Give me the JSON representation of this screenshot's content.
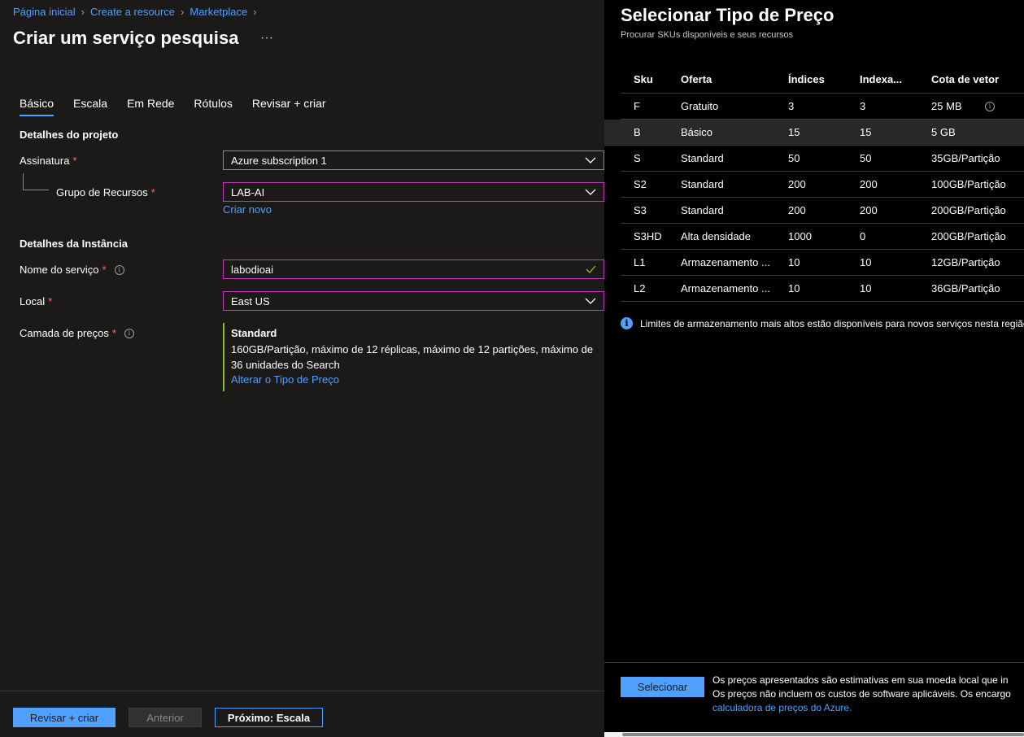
{
  "breadcrumb": [
    "Página inicial",
    "Create a resource",
    "Marketplace"
  ],
  "page_title": "Criar um serviço pesquisa",
  "more_label": "···",
  "tabs": [
    "Básico",
    "Escala",
    "Em Rede",
    "Rótulos",
    "Revisar + criar"
  ],
  "project": {
    "heading": "Detalhes do projeto",
    "subscription_label": "Assinatura",
    "subscription_value": "Azure subscription 1",
    "resource_group_label": "Grupo de Recursos",
    "resource_group_value": "LAB-AI",
    "create_new": "Criar novo",
    "required_mark": "*"
  },
  "instance": {
    "heading": "Detalhes da Instância",
    "service_name_label": "Nome do serviço",
    "service_name_value": "labodioai",
    "location_label": "Local",
    "location_value": "East US",
    "tier_label": "Camada de preços",
    "tier_name": "Standard",
    "tier_desc": "160GB/Partição, máximo de 12 réplicas, máximo de 12 partições, máximo de 36 unidades do Search",
    "tier_change": "Alterar o Tipo de Preço"
  },
  "footer": {
    "review_create": "Revisar + criar",
    "previous": "Anterior",
    "next": "Próximo: Escala"
  },
  "panel": {
    "title": "Selecionar Tipo de Preço",
    "subtitle": "Procurar SKUs disponíveis e seus recursos",
    "columns": [
      "Sku",
      "Oferta",
      "Índices",
      "Indexa...",
      "Cota de vetor"
    ],
    "rows": [
      {
        "sku": "F",
        "offer": "Gratuito",
        "indexes": "3",
        "indexers": "3",
        "quota": "25 MB"
      },
      {
        "sku": "B",
        "offer": "Básico",
        "indexes": "15",
        "indexers": "15",
        "quota": "5 GB"
      },
      {
        "sku": "S",
        "offer": "Standard",
        "indexes": "50",
        "indexers": "50",
        "quota": "35GB/Partição"
      },
      {
        "sku": "S2",
        "offer": "Standard",
        "indexes": "200",
        "indexers": "200",
        "quota": "100GB/Partição"
      },
      {
        "sku": "S3",
        "offer": "Standard",
        "indexes": "200",
        "indexers": "200",
        "quota": "200GB/Partição"
      },
      {
        "sku": "S3HD",
        "offer": "Alta densidade",
        "indexes": "1000",
        "indexers": "0",
        "quota": "200GB/Partição"
      },
      {
        "sku": "L1",
        "offer": "Armazenamento ...",
        "indexes": "10",
        "indexers": "10",
        "quota": "12GB/Partição"
      },
      {
        "sku": "L2",
        "offer": "Armazenamento ...",
        "indexes": "10",
        "indexers": "10",
        "quota": "36GB/Partição"
      }
    ],
    "info_message": "Limites de armazenamento mais altos estão disponíveis para novos serviços nesta região",
    "select_button": "Selecionar",
    "note_line1": "Os preços apresentados são estimativas em sua moeda local que in",
    "note_line2": "Os preços não incluem os custos de software aplicáveis. Os encargo",
    "note_link": "calculadora de preços do Azure."
  }
}
